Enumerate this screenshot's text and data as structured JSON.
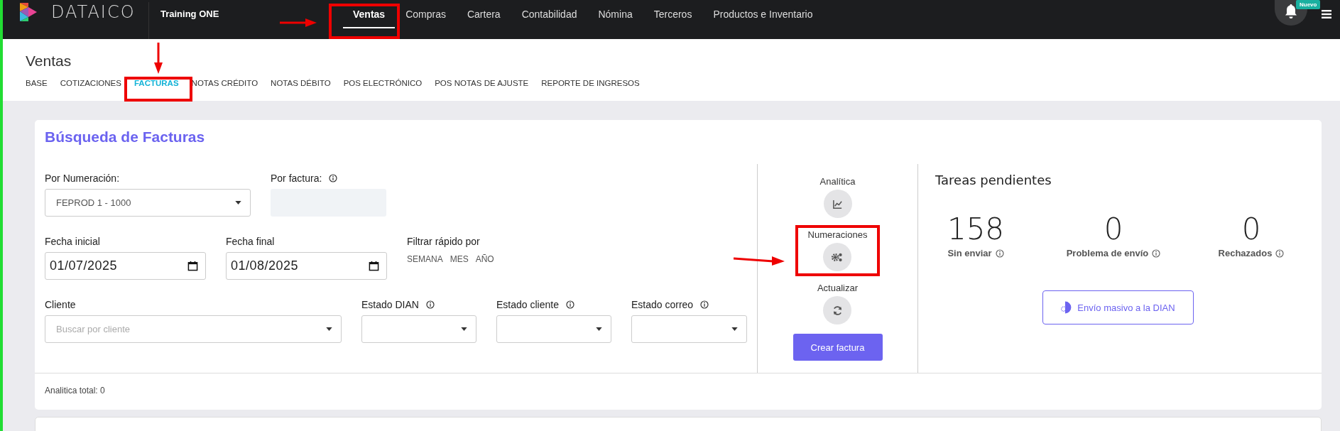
{
  "app": {
    "brand": "DATAICO",
    "company": "Training ONE"
  },
  "nav": [
    {
      "label": "Ventas",
      "selected": true
    },
    {
      "label": "Compras",
      "selected": false
    },
    {
      "label": "Cartera",
      "selected": false
    },
    {
      "label": "Contabilidad",
      "selected": false
    },
    {
      "label": "Nómina",
      "selected": false
    },
    {
      "label": "Terceros",
      "selected": false
    },
    {
      "label": "Productos e Inventario",
      "selected": false
    }
  ],
  "notifications": {
    "badge": "Nuevo"
  },
  "page": {
    "title": "Ventas"
  },
  "tabs": [
    {
      "label": "BASE",
      "selected": false
    },
    {
      "label": "COTIZACIONES",
      "selected": false
    },
    {
      "label": "FACTURAS",
      "selected": true
    },
    {
      "label": "NOTAS CRÉDITO",
      "selected": false
    },
    {
      "label": "NOTAS DÉBITO",
      "selected": false
    },
    {
      "label": "POS ELECTRÓNICO",
      "selected": false
    },
    {
      "label": "POS NOTAS DE AJUSTE",
      "selected": false
    },
    {
      "label": "REPORTE DE INGRESOS",
      "selected": false
    }
  ],
  "search": {
    "title": "Búsqueda de Facturas",
    "filter_rows": [
      [
        {
          "kind": "select",
          "label": "Por Numeración:",
          "info": false,
          "value": "FEPROD 1 - 1000"
        },
        {
          "kind": "text",
          "label": "Por factura:",
          "info": true
        }
      ],
      [
        {
          "kind": "date",
          "label": "Fecha inicial",
          "info": false,
          "value": "01/07/2025"
        },
        {
          "kind": "date",
          "label": "Fecha final",
          "info": false,
          "value": "01/08/2025"
        },
        {
          "kind": "quick",
          "label": "Filtrar rápido por",
          "info": false,
          "options": [
            "SEMANA",
            "MES",
            "AÑO"
          ]
        }
      ],
      [
        {
          "kind": "select",
          "label": "Cliente",
          "info": false,
          "placeholder": "Buscar por cliente"
        },
        {
          "kind": "select",
          "label": "Estado DIAN",
          "info": true
        },
        {
          "kind": "select",
          "label": "Estado cliente",
          "info": true
        },
        {
          "kind": "select",
          "label": "Estado correo",
          "info": true
        }
      ]
    ],
    "actions": [
      {
        "kind": "chart",
        "label": "Analítica"
      },
      {
        "kind": "gears",
        "label": "Numeraciones"
      },
      {
        "kind": "refresh",
        "label": "Actualizar"
      }
    ],
    "create_button": "Crear factura",
    "pending": {
      "title": "Tareas pendientes",
      "stats": [
        {
          "value": "158",
          "label": "Sin enviar"
        },
        {
          "value": "0",
          "label": "Problema de envío"
        },
        {
          "value": "0",
          "label": "Rechazados"
        }
      ],
      "bulk_button": "Envío masivo a la DIAN"
    },
    "total": "Analitica total: 0"
  }
}
